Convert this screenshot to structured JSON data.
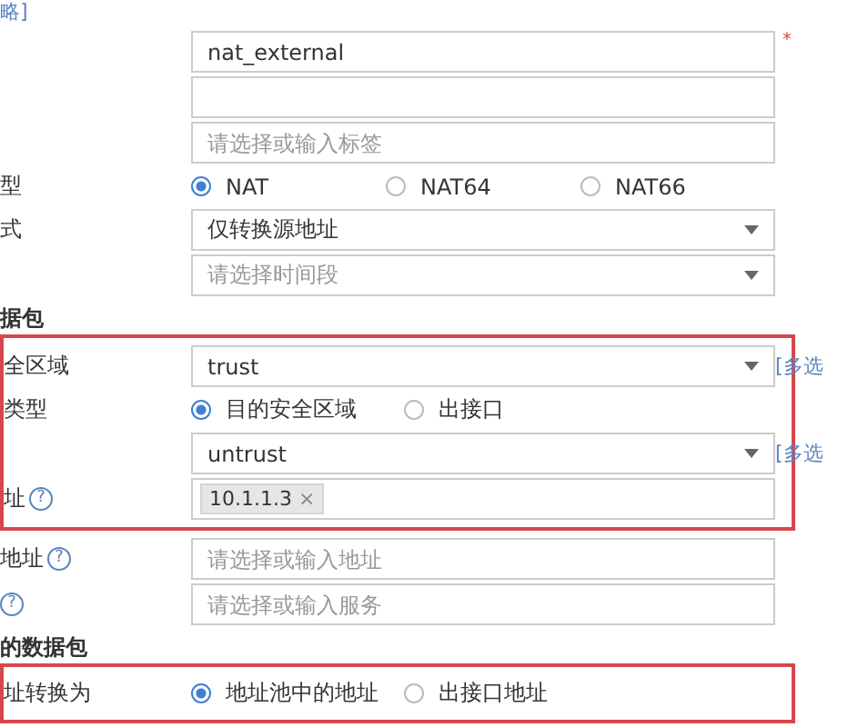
{
  "top_link": "略]",
  "sections": [
    {
      "highlighted": false,
      "rows": [
        {
          "kind": "input",
          "value": "nat_external",
          "required": "*"
        },
        {
          "kind": "input"
        },
        {
          "kind": "input",
          "placeholder": "请选择或输入标签"
        },
        {
          "kind": "radio",
          "label": "型",
          "options": [
            {
              "label": "NAT",
              "selected": true
            },
            {
              "label": "NAT64",
              "selected": false
            },
            {
              "label": "NAT66",
              "selected": false
            }
          ]
        },
        {
          "kind": "select",
          "label": "式",
          "value": "仅转换源地址"
        },
        {
          "kind": "select",
          "placeholder": "请选择时间段"
        }
      ]
    },
    {
      "heading": "据包",
      "highlighted": true,
      "rows": [
        {
          "kind": "select",
          "label": "全区域",
          "value": "trust",
          "side_link": "[多选"
        },
        {
          "kind": "radio",
          "label": "类型",
          "options": [
            {
              "label": "目的安全区域",
              "selected": true
            },
            {
              "label": "出接口",
              "selected": false
            }
          ]
        },
        {
          "kind": "select",
          "value": "untrust",
          "side_link": "[多选"
        },
        {
          "kind": "tags",
          "label": "址",
          "help": "?",
          "tags": [
            {
              "text": "10.1.1.3",
              "remove": "×"
            }
          ]
        }
      ]
    },
    {
      "highlighted": false,
      "rows": [
        {
          "kind": "input",
          "label": "地址",
          "help": "?",
          "placeholder": "请选择或输入地址"
        },
        {
          "kind": "input",
          "help": "?",
          "placeholder": "请选择或输入服务"
        }
      ]
    },
    {
      "heading": "的数据包",
      "highlighted": true,
      "rows": [
        {
          "kind": "radio",
          "label": "址转换为",
          "options": [
            {
              "label": "地址池中的地址",
              "selected": true
            },
            {
              "label": "出接口地址",
              "selected": false
            }
          ]
        }
      ]
    }
  ]
}
